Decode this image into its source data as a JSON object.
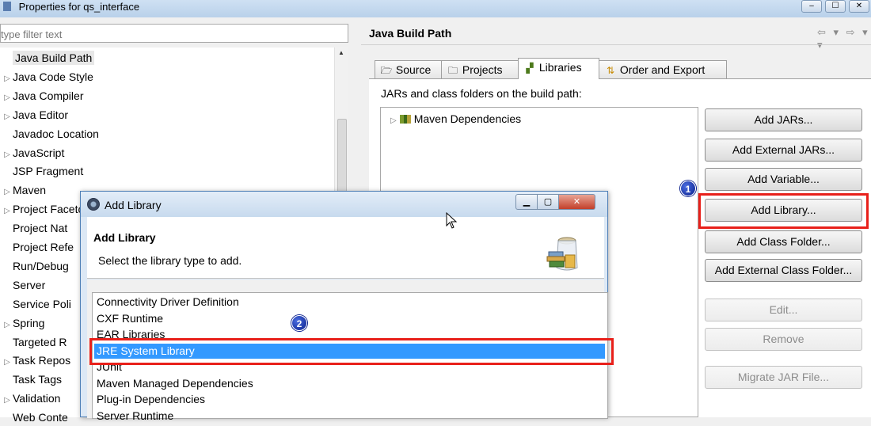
{
  "window": {
    "title": "Properties for qs_interface",
    "controls": {
      "minimize": "–",
      "maximize": "☐",
      "close": "✕"
    }
  },
  "left_panel": {
    "filter_placeholder": "type filter text",
    "items": [
      {
        "label": "Java Build Path",
        "expandable": false,
        "selected": true
      },
      {
        "label": "Java Code Style",
        "expandable": true
      },
      {
        "label": "Java Compiler",
        "expandable": true
      },
      {
        "label": "Java Editor",
        "expandable": true
      },
      {
        "label": "Javadoc Location",
        "expandable": false
      },
      {
        "label": "JavaScript",
        "expandable": true
      },
      {
        "label": "JSP Fragment",
        "expandable": false
      },
      {
        "label": "Maven",
        "expandable": true
      },
      {
        "label": "Project Faceto",
        "expandable": true
      },
      {
        "label": "Project Nat",
        "expandable": false
      },
      {
        "label": "Project Refe",
        "expandable": false
      },
      {
        "label": "Run/Debug",
        "expandable": false
      },
      {
        "label": "Server",
        "expandable": false
      },
      {
        "label": "Service Poli",
        "expandable": false
      },
      {
        "label": "Spring",
        "expandable": true
      },
      {
        "label": "Targeted R",
        "expandable": false
      },
      {
        "label": "Task Repos",
        "expandable": true
      },
      {
        "label": "Task Tags",
        "expandable": false
      },
      {
        "label": "Validation",
        "expandable": true
      },
      {
        "label": "Web Conte",
        "expandable": false
      }
    ]
  },
  "right_panel": {
    "title": "Java Build Path",
    "nav": "⇦ ▾ ⇨ ▾ ▾",
    "tabs": [
      {
        "label": "Source",
        "icon": "source-icon"
      },
      {
        "label": "Projects",
        "icon": "projects-icon"
      },
      {
        "label": "Libraries",
        "icon": "libraries-icon",
        "active": true
      },
      {
        "label": "Order and Export",
        "icon": "order-icon"
      }
    ],
    "caption": "JARs and class folders on the build path:",
    "build_path_items": [
      {
        "label": "Maven Dependencies"
      }
    ],
    "buttons": {
      "add_jars": "Add JARs...",
      "add_external_jars": "Add External JARs...",
      "add_variable": "Add Variable...",
      "add_library": "Add Library...",
      "add_class_folder": "Add Class Folder...",
      "add_external_class_folder": "Add External Class Folder...",
      "edit": "Edit...",
      "remove": "Remove",
      "migrate_jar": "Migrate JAR File..."
    }
  },
  "dialog": {
    "title": "Add Library",
    "header_title": "Add Library",
    "header_subtitle": "Select the library type to add.",
    "items": [
      "Connectivity Driver Definition",
      "CXF Runtime",
      "EAR Libraries",
      "JRE System Library",
      "JUnit",
      "Maven Managed Dependencies",
      "Plug-in Dependencies",
      "Server Runtime"
    ],
    "selected_index": 3
  },
  "annotations": {
    "step1": "1",
    "step2": "2",
    "highlight_color": "#e8201a"
  }
}
